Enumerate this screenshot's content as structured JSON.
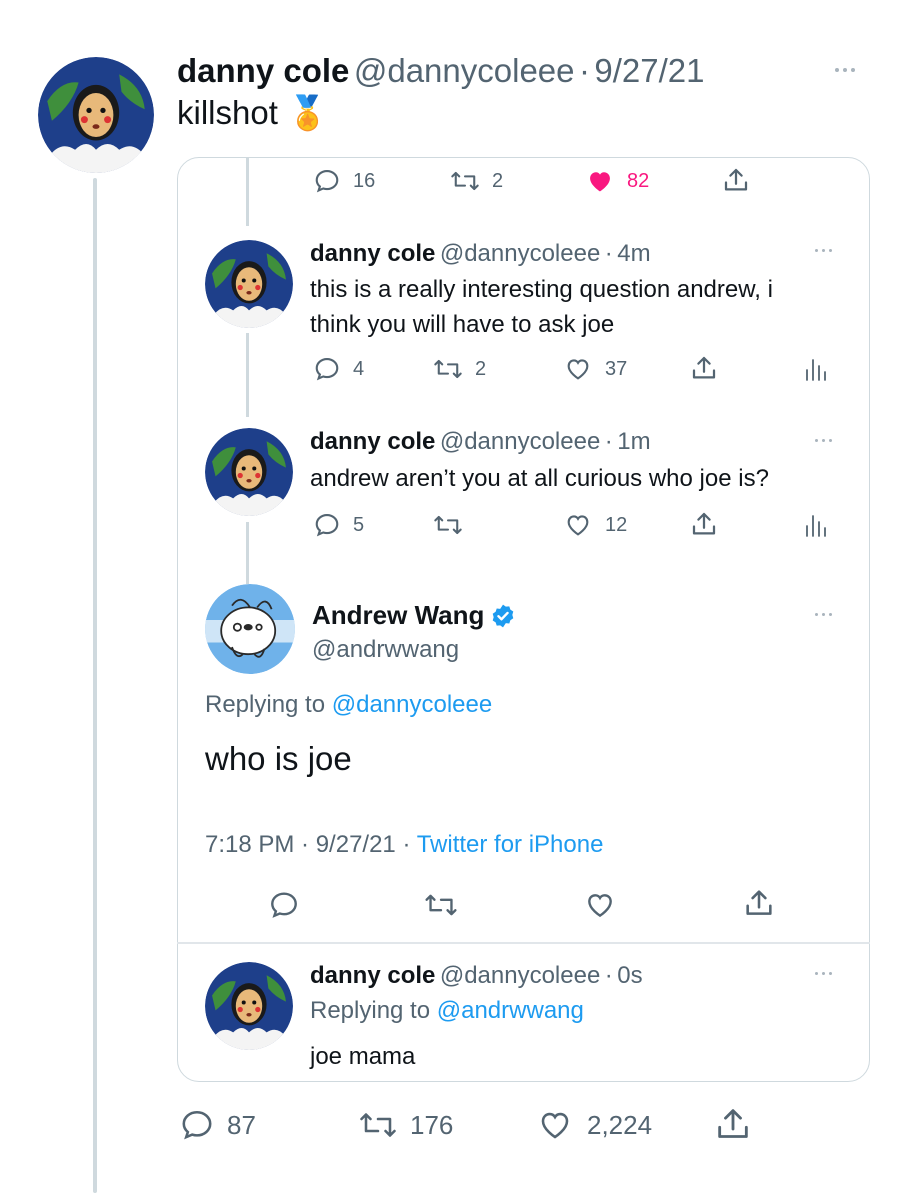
{
  "main_tweet": {
    "name": "danny cole",
    "handle": "@dannycoleee",
    "separator": "·",
    "date": "9/27/21",
    "text": "killshot",
    "emoji": "🏅",
    "actions": {
      "replies": "87",
      "retweets": "176",
      "likes": "2,224"
    }
  },
  "quoted_top_actions": {
    "replies": "16",
    "retweets": "2",
    "likes": "82"
  },
  "reply_1": {
    "name": "danny cole",
    "handle": "@dannycoleee",
    "time": "4m",
    "text_line1": "this is a really interesting question andrew, i",
    "text_line2": "think you will have to ask joe",
    "actions": {
      "replies": "4",
      "retweets": "2",
      "likes": "37"
    }
  },
  "reply_2": {
    "name": "danny cole",
    "handle": "@dannycoleee",
    "time": "1m",
    "text": "andrew aren’t you at all curious who joe is?",
    "actions": {
      "replies": "5",
      "likes": "12"
    }
  },
  "focal": {
    "name": "Andrew Wang",
    "handle": "@andrwwang",
    "replying_prefix": "Replying to",
    "replying_handle": "@dannycoleee",
    "text": "who is joe",
    "timestamp": "7:18 PM · 9/27/21 · ",
    "source": "Twitter for iPhone"
  },
  "reply_3": {
    "name": "danny cole",
    "handle": "@dannycoleee",
    "time": "0s",
    "replying_prefix": "Replying to",
    "replying_handle": "@andrwwang",
    "text": "joe mama"
  },
  "colors": {
    "accent": "#1d9bf0",
    "like_active": "#f91880",
    "text": "#0f1419",
    "secondary": "#536471"
  }
}
